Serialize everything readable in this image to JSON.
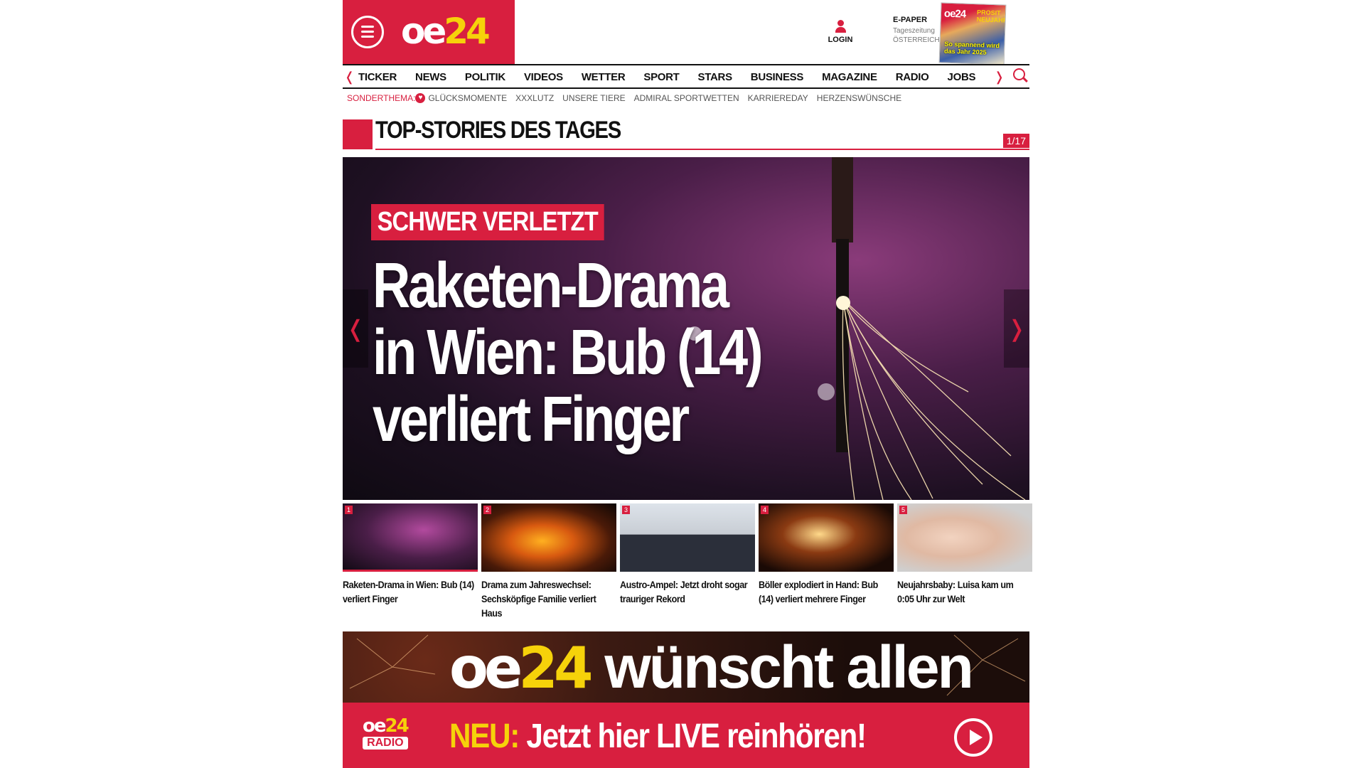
{
  "header": {
    "logo": {
      "main": "oe",
      "accent": "24"
    },
    "login_label": "LOGIN",
    "epaper": {
      "title": "E-PAPER",
      "line1": "Tageszeitung",
      "line2": "ÖSTERREICH"
    },
    "epaper_cover": {
      "logo": "oe24",
      "badge": "PROSIT NEUJAHR!",
      "headline": "So spannend wird das Jahr 2025"
    }
  },
  "nav": {
    "items": [
      "TICKER",
      "NEWS",
      "POLITIK",
      "VIDEOS",
      "WETTER",
      "SPORT",
      "STARS",
      "BUSINESS",
      "MAGAZINE",
      "RADIO",
      "JOBS"
    ]
  },
  "sonderthema": {
    "label": "SONDERTHEMA:",
    "items": [
      "GLÜCKSMOMENTE",
      "XXXLUTZ",
      "UNSERE TIERE",
      "ADMIRAL SPORTWETTEN",
      "KARRIEREDAY",
      "HERZENSWÜNSCHE"
    ]
  },
  "section": {
    "title": "TOP-STORIES DES TAGES",
    "counter": "1/17"
  },
  "hero": {
    "kicker": "SCHWER VERLETZT",
    "headline": "Raketen-Drama in Wien: Bub (14) verliert Finger"
  },
  "thumbnails": [
    {
      "num": "1",
      "caption": "Raketen-Drama in Wien: Bub (14) verliert Finger"
    },
    {
      "num": "2",
      "caption": "Drama zum Jahreswechsel: Sechsköpfige Familie verliert Haus"
    },
    {
      "num": "3",
      "caption": "Austro-Ampel: Jetzt droht sogar trauriger Rekord"
    },
    {
      "num": "4",
      "caption": "Böller explodiert in Hand: Bub (14) verliert mehrere Finger"
    },
    {
      "num": "5",
      "caption": "Neujahrsbaby: Luisa kam um 0:05 Uhr zur Welt"
    }
  ],
  "banner": {
    "logo_main": "oe",
    "logo_accent": "24",
    "text": "wünscht allen"
  },
  "radio": {
    "logo_main": "oe",
    "logo_accent": "24",
    "logo_sub": "RADIO",
    "prefix": "NEU:",
    "text": "Jetzt hier LIVE reinhören!"
  },
  "colors": {
    "brand_red": "#d81f3f",
    "brand_yellow": "#f6d20a"
  },
  "icons": [
    "menu-icon",
    "user-icon",
    "search-icon",
    "chevron-left-icon",
    "chevron-right-icon",
    "heart-icon",
    "play-icon"
  ]
}
